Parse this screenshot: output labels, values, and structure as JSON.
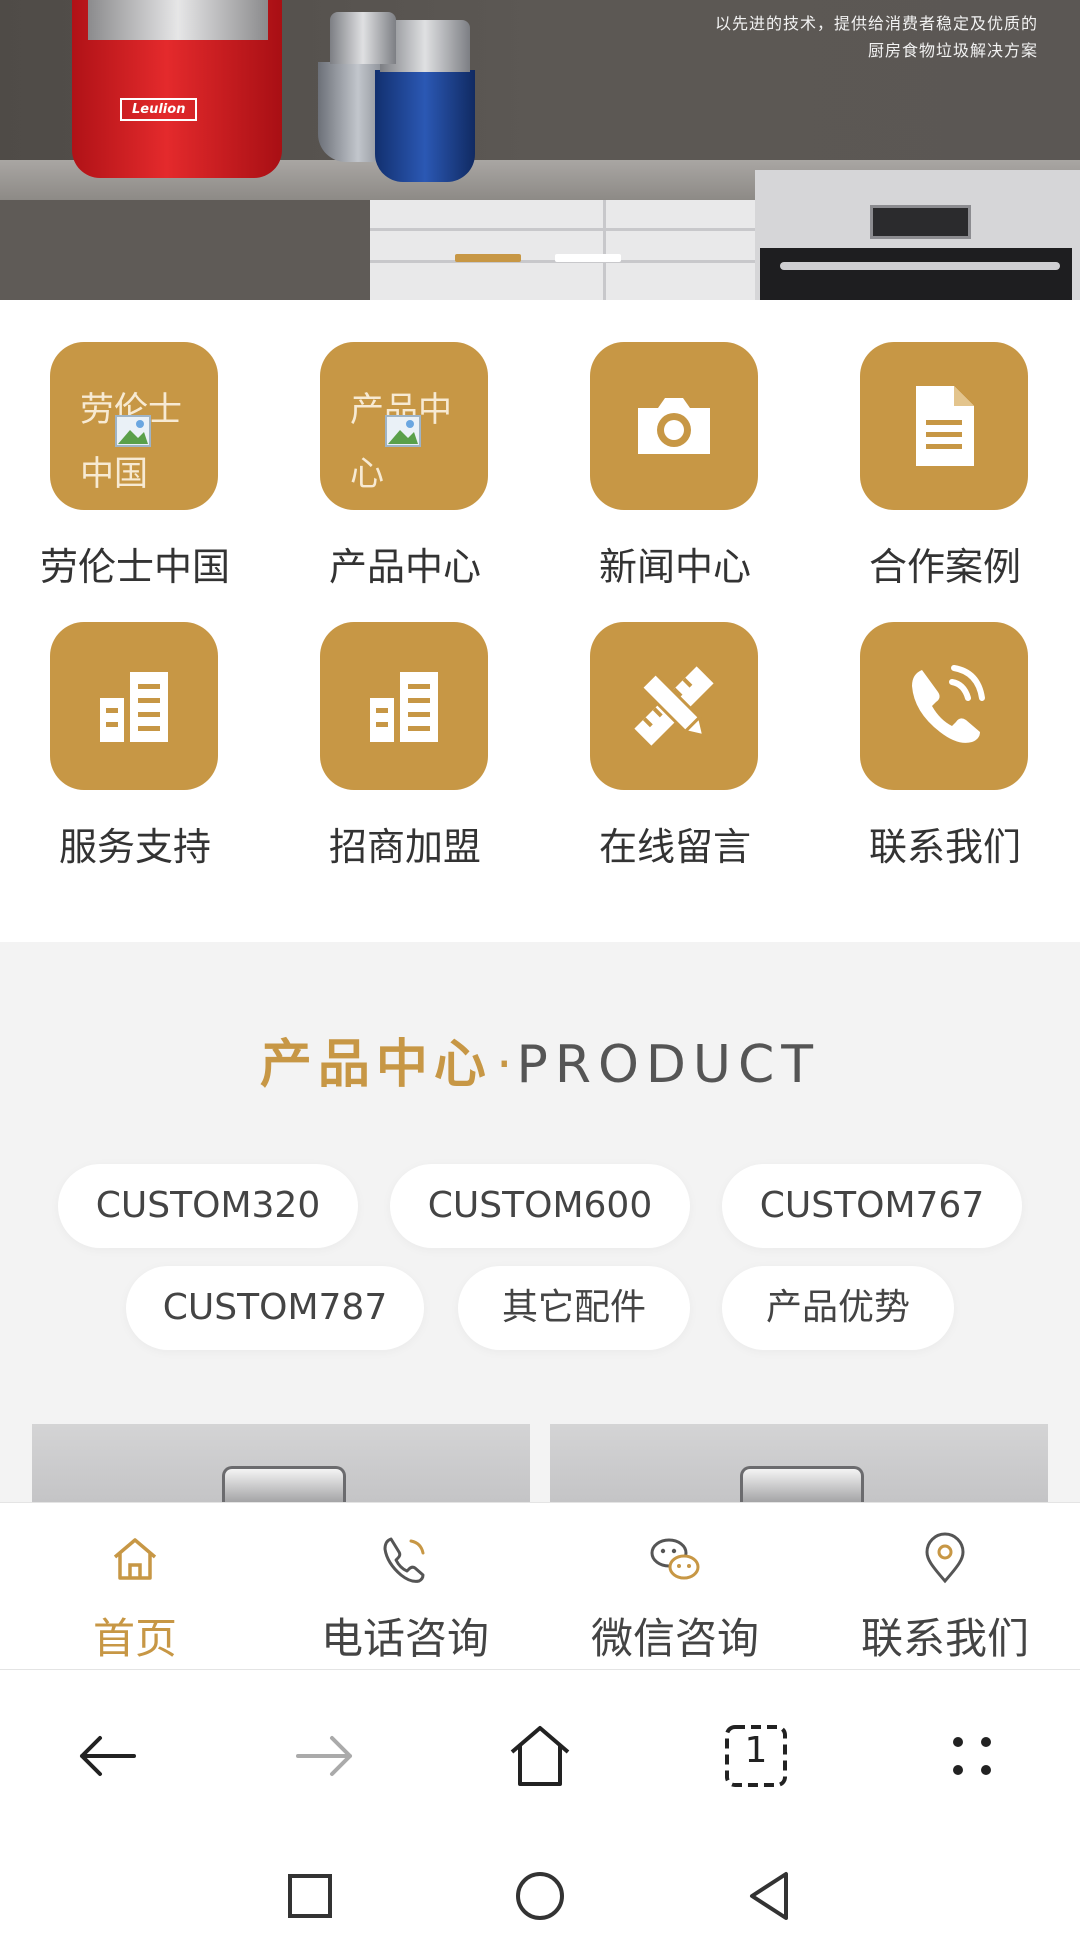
{
  "banner": {
    "tagline_line1": "以先进的技术，提供给消费者稳定及优质的",
    "tagline_line2": "厨房食物垃圾解决方案",
    "brand_text": "Leulion",
    "slide_count": 2,
    "active_slide": 1,
    "colors": {
      "active_dot": "#c79745",
      "inactive_dot": "#ffffff"
    }
  },
  "nav_grid": {
    "items": [
      {
        "label": "劳伦士中国",
        "icon": "broken-image-icon",
        "alt": "劳伦士中国"
      },
      {
        "label": "产品中心",
        "icon": "broken-image-icon",
        "alt": "产品中心"
      },
      {
        "label": "新闻中心",
        "icon": "camera-icon"
      },
      {
        "label": "合作案例",
        "icon": "document-icon"
      },
      {
        "label": "服务支持",
        "icon": "buildings-icon"
      },
      {
        "label": "招商加盟",
        "icon": "buildings-icon"
      },
      {
        "label": "在线留言",
        "icon": "pencil-ruler-icon"
      },
      {
        "label": "联系我们",
        "icon": "phone-icon"
      }
    ],
    "tile_color": "#c79745"
  },
  "products": {
    "title_cn": "产品中心",
    "title_sep": "·",
    "title_en": "PRODUCT",
    "categories": [
      "CUSTOM320",
      "CUSTOM600",
      "CUSTOM767",
      "CUSTOM787",
      "其它配件",
      "产品优势"
    ]
  },
  "bottom_nav": {
    "items": [
      {
        "label": "首页",
        "icon": "home-icon",
        "active": true
      },
      {
        "label": "电话咨询",
        "icon": "phone-call-icon",
        "active": false
      },
      {
        "label": "微信咨询",
        "icon": "wechat-icon",
        "active": false
      },
      {
        "label": "联系我们",
        "icon": "location-pin-icon",
        "active": false
      }
    ],
    "accent": "#c79745"
  },
  "browser_toolbar": {
    "tab_count": "1",
    "buttons": [
      "back-arrow-icon",
      "forward-arrow-icon",
      "home-outline-icon",
      "tabs-icon",
      "more-dots-icon"
    ]
  },
  "system_nav": {
    "buttons": [
      "recents-square-icon",
      "home-circle-icon",
      "back-triangle-icon"
    ]
  }
}
